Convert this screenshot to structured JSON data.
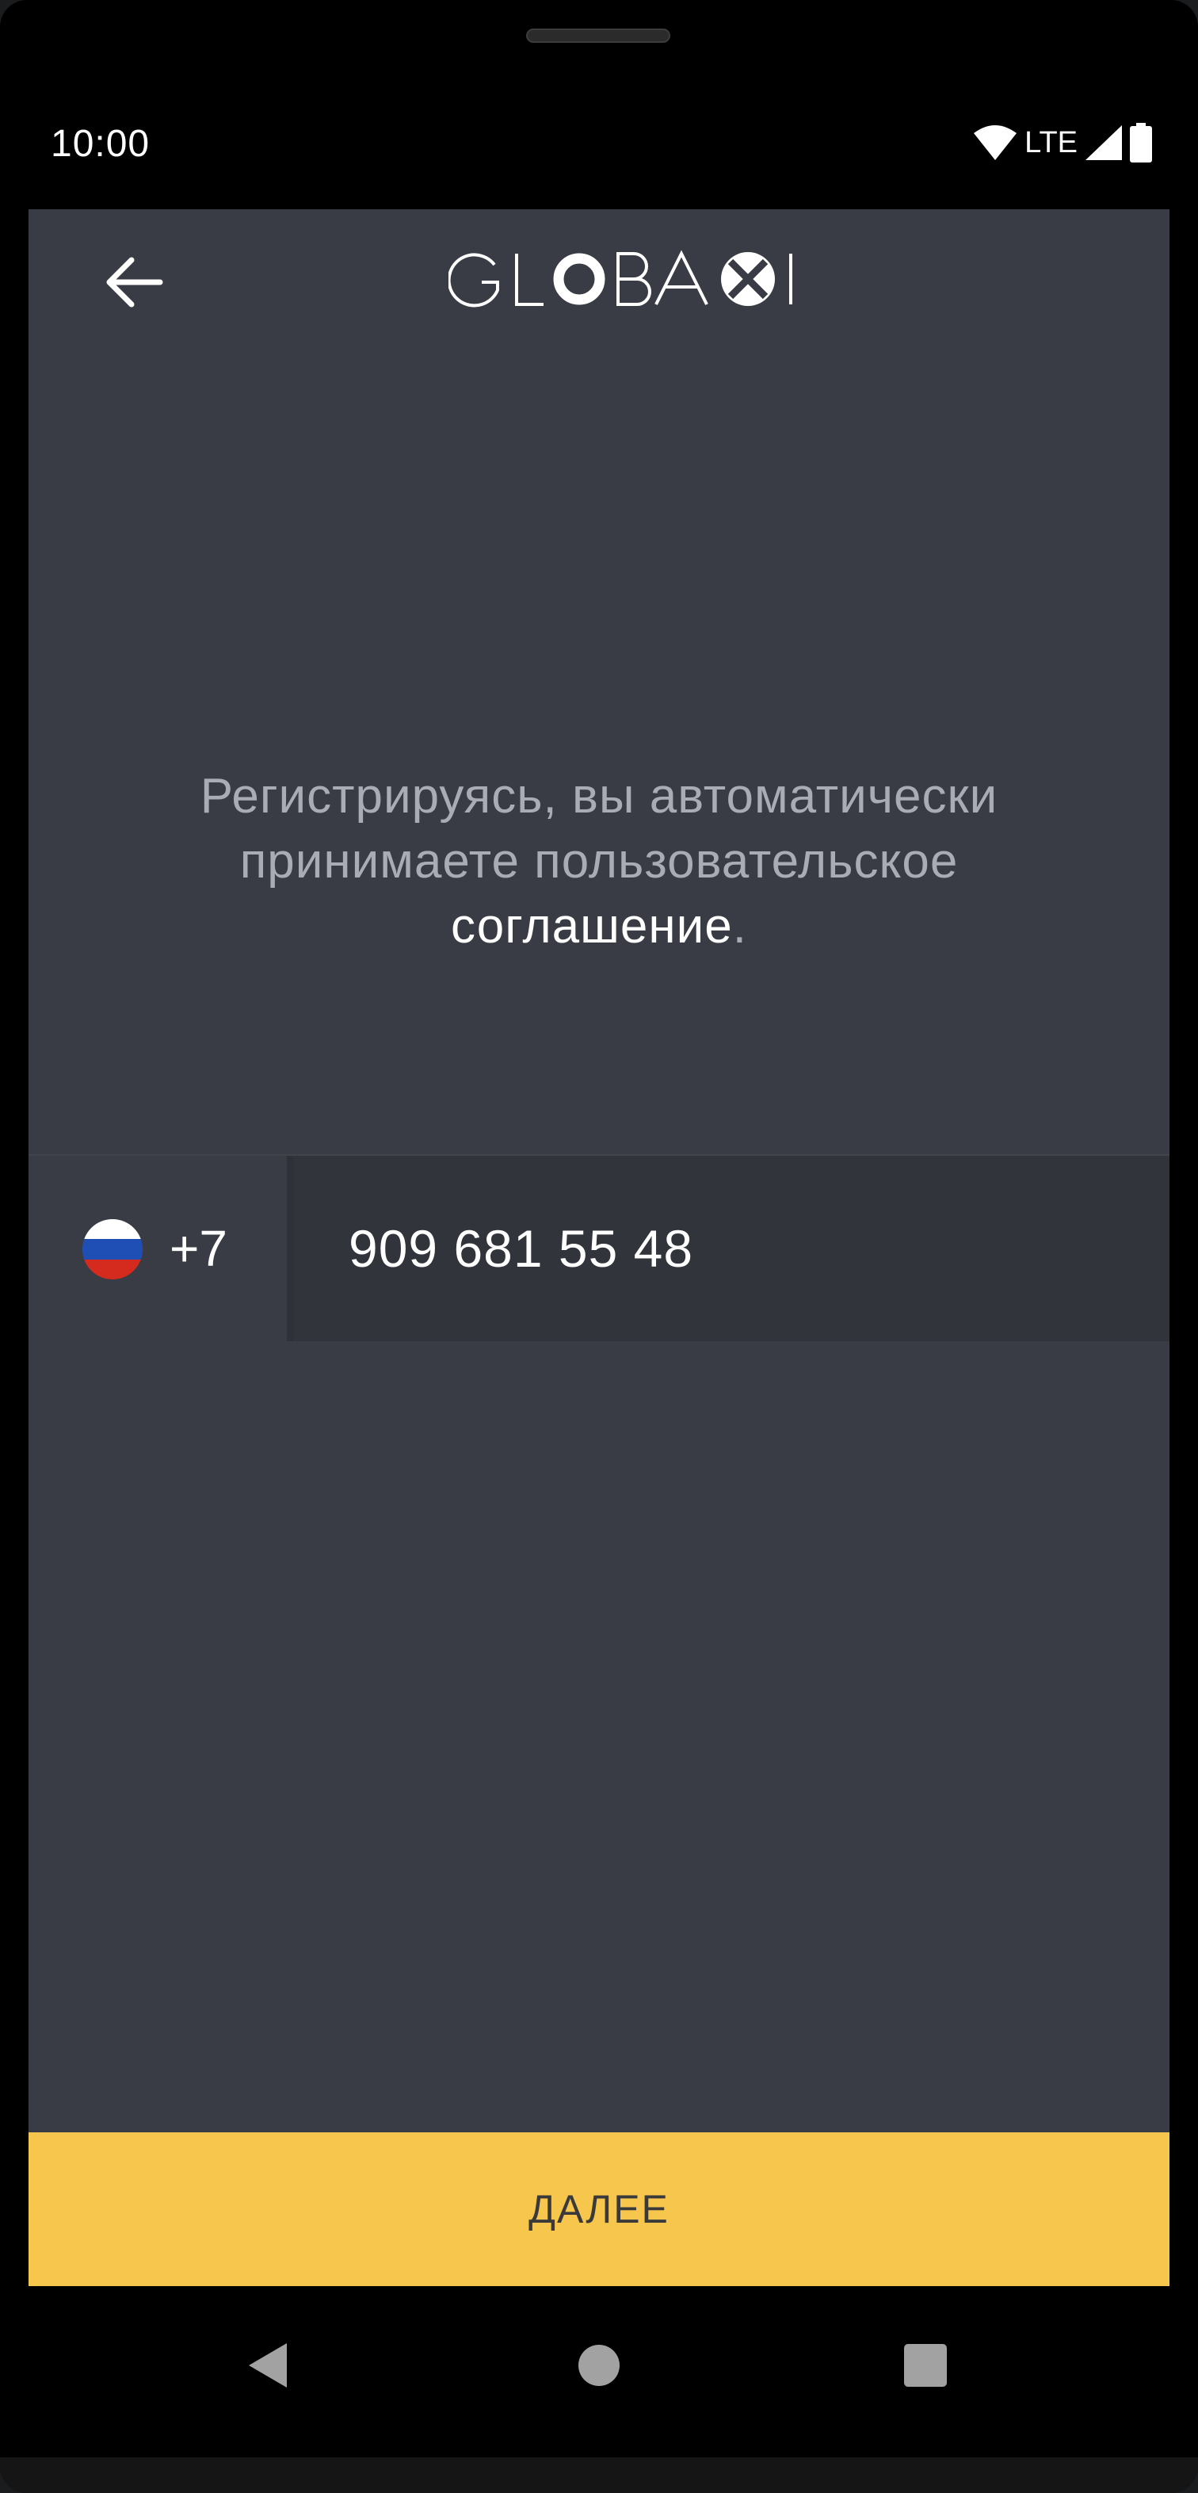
{
  "status_bar": {
    "time": "10:00",
    "network": "LTE",
    "icons": [
      "wifi-icon",
      "signal-icon",
      "battery-icon"
    ]
  },
  "header": {
    "logo_text": "GLOBAXI",
    "back_icon": "arrow-left-icon"
  },
  "terms": {
    "line1": "Регистрируясь, вы автоматически",
    "line2": "принимаете пользовательское",
    "link_text": "соглашение",
    "end": "."
  },
  "phone": {
    "country_code": "+7",
    "flag_icon": "russia-flag-icon",
    "number": "909 681 55 48"
  },
  "actions": {
    "next_label": "ДАЛЕЕ"
  },
  "navigation": {
    "icons": [
      "nav-back-icon",
      "nav-home-icon",
      "nav-recents-icon"
    ]
  },
  "colors": {
    "background": "#393c44",
    "input_background": "#31343b",
    "accent": "#f7c64d",
    "muted_text": "#a9acb4",
    "text": "#ffffff"
  }
}
